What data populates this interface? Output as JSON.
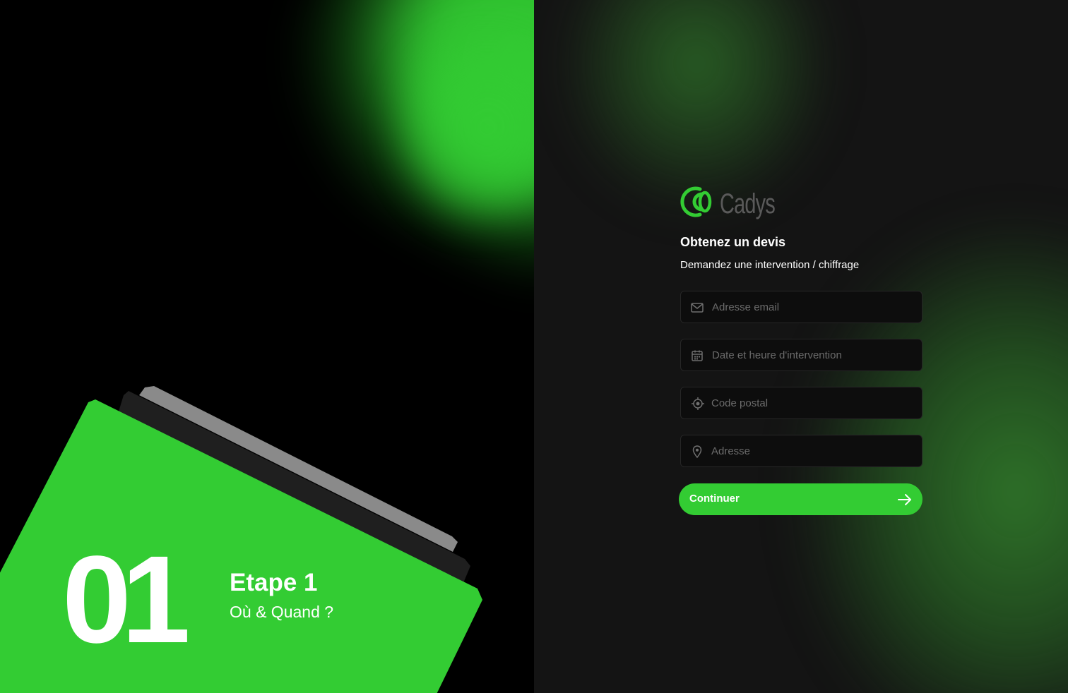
{
  "colors": {
    "accent": "#33cc33",
    "left_bg": "#000000",
    "right_bg": "#141414",
    "field_bg": "#0d0d0d",
    "card_dark": "#1f1f1f",
    "card_gray": "#8a8a8a",
    "logo_text": "#5a5a5a"
  },
  "step": {
    "number": "01",
    "title": "Etape 1",
    "subtitle": "Où & Quand ?"
  },
  "brand": {
    "name": "Cadys",
    "logo_icon": "cadys-logo-icon"
  },
  "form": {
    "title": "Obtenez un devis",
    "subtitle": "Demandez une intervention / chiffrage",
    "fields": [
      {
        "icon": "mail-icon",
        "placeholder": "Adresse email",
        "value": ""
      },
      {
        "icon": "calendar-icon",
        "placeholder": "Date et heure d'intervention",
        "value": ""
      },
      {
        "icon": "crosshair-icon",
        "placeholder": "Code postal",
        "value": ""
      },
      {
        "icon": "map-pin-icon",
        "placeholder": "Adresse",
        "value": ""
      }
    ],
    "submit_label": "Continuer",
    "submit_icon": "arrow-right-icon"
  }
}
